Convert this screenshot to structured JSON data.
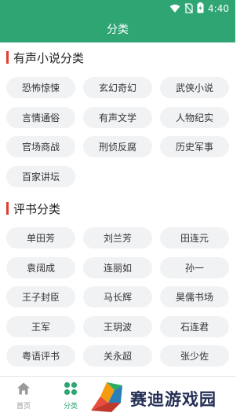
{
  "status_bar": {
    "time": "4:40"
  },
  "header": {
    "title": "分类"
  },
  "sections": [
    {
      "title": "有声小说分类",
      "items": [
        "恐怖惊悚",
        "玄幻奇幻",
        "武侠小说",
        "言情通俗",
        "有声文学",
        "人物纪实",
        "官场商战",
        "刑侦反腐",
        "历史军事",
        "百家讲坛"
      ]
    },
    {
      "title": "评书分类",
      "items": [
        "单田芳",
        "刘兰芳",
        "田连元",
        "袁阔成",
        "连丽如",
        "孙一",
        "王子封臣",
        "马长辉",
        "昊儒书场",
        "王军",
        "王玥波",
        "石连君",
        "粤语评书",
        "关永超",
        "张少佐"
      ]
    }
  ],
  "bottom_nav": [
    {
      "label": "首页",
      "icon": "home-icon",
      "active": false
    },
    {
      "label": "分类",
      "icon": "category-icon",
      "active": true
    }
  ],
  "watermark": {
    "text": "赛迪游戏园"
  },
  "colors": {
    "primary": "#2fa574",
    "accent_bar": "#e23b30",
    "chip_bg": "#f1f2f4"
  }
}
